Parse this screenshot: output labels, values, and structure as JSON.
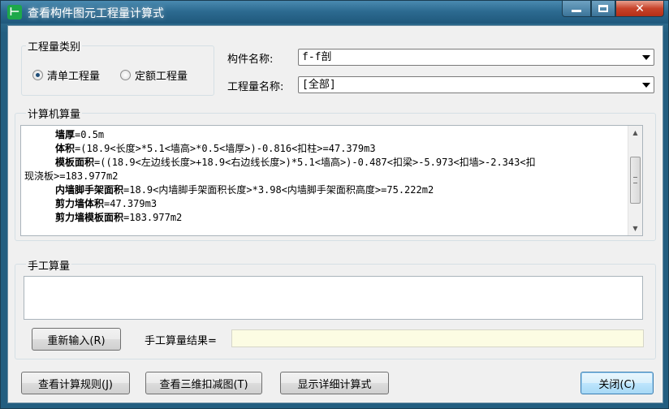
{
  "window": {
    "title": "查看构件图元工程量计算式",
    "app_icon_glyph": "⊢",
    "minimize": "—",
    "close": "✕"
  },
  "quantity_type": {
    "label": "工程量类别",
    "options": [
      {
        "label": "清单工程量",
        "checked": true
      },
      {
        "label": "定额工程量",
        "checked": false
      }
    ]
  },
  "component": {
    "name_label": "构件名称:",
    "name_value": "f-f剖",
    "quantity_name_label": "工程量名称:",
    "quantity_name_value": "[全部]"
  },
  "computed": {
    "label": "计算机算量",
    "lines": [
      {
        "term": "墙厚",
        "expr": "=0.5m"
      },
      {
        "term": "体积",
        "expr": "=(18.9<长度>*5.1<墙高>*0.5<墙厚>)-0.816<扣柱>=47.379m3"
      },
      {
        "term": "模板面积",
        "expr": "=((18.9<左边线长度>+18.9<右边线长度>)*5.1<墙高>)-0.487<扣梁>-5.973<扣墙>-2.343<扣"
      },
      {
        "term": "",
        "expr": "现浇板>=183.977m2"
      },
      {
        "term": "内墙脚手架面积",
        "expr": "=18.9<内墙脚手架面积长度>*3.98<内墙脚手架面积高度>=75.222m2"
      },
      {
        "term": "剪力墙体积",
        "expr": "=47.379m3"
      },
      {
        "term": "剪力墙模板面积",
        "expr": "=183.977m2"
      }
    ]
  },
  "manual": {
    "label": "手工算量",
    "reenter_button": "重新输入(R)",
    "result_label": "手工算量结果=",
    "result_value": ""
  },
  "buttons": {
    "view_rules": "查看计算规则(J)",
    "view_3d": "查看三维扣减图(T)",
    "show_detail": "显示详细计算式",
    "close": "关闭(C)"
  }
}
